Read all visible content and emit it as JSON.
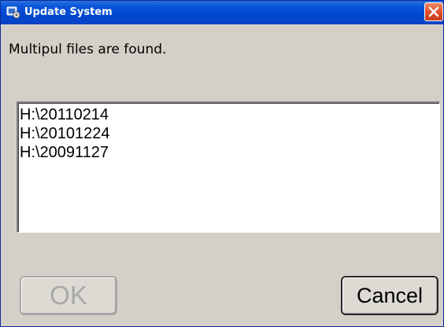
{
  "window": {
    "title": "Update System",
    "accent": "#0047d0",
    "close_color": "#e0502c"
  },
  "message": "Multipul files are found.",
  "files": [
    "H:\\20110214",
    "H:\\20101224",
    "H:\\20091127"
  ],
  "buttons": {
    "ok_label": "OK",
    "ok_enabled": false,
    "cancel_label": "Cancel",
    "cancel_enabled": true
  },
  "icons": {
    "title_icon": "update-system-icon",
    "close_icon": "close-icon"
  }
}
